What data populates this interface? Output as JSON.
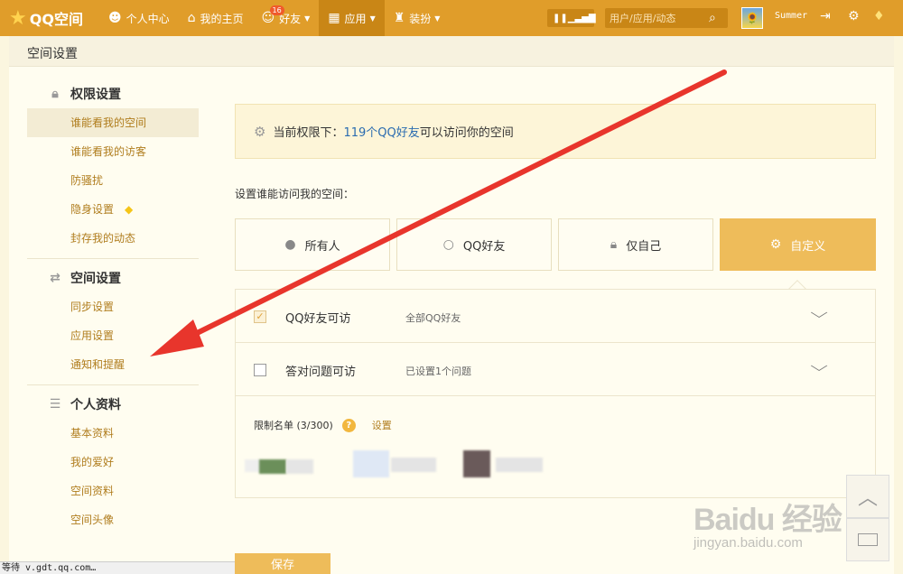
{
  "nav": {
    "logo_text": "QQ空间",
    "items": [
      {
        "label": "个人中心",
        "icon": "person-icon"
      },
      {
        "label": "我的主页",
        "icon": "home-icon"
      },
      {
        "label": "好友",
        "icon": "friends-icon",
        "badge": "16"
      },
      {
        "label": "应用",
        "icon": "grid-icon"
      },
      {
        "label": "装扮",
        "icon": "shirt-icon"
      }
    ],
    "search_placeholder": "用户/应用/动态",
    "username": "Summer"
  },
  "page": {
    "title": "空间设置"
  },
  "sidebar": {
    "sections": [
      {
        "title": "权限设置",
        "icon": "lock-icon",
        "items": [
          "谁能看我的空间",
          "谁能看我的访客",
          "防骚扰",
          "隐身设置",
          "封存我的动态"
        ]
      },
      {
        "title": "空间设置",
        "icon": "space-icon",
        "items": [
          "同步设置",
          "应用设置",
          "通知和提醒"
        ]
      },
      {
        "title": "个人资料",
        "icon": "profile-icon",
        "items": [
          "基本资料",
          "我的爱好",
          "空间资料",
          "空间头像"
        ]
      }
    ]
  },
  "notice": {
    "prefix": "当前权限下：",
    "highlight": "119个QQ好友",
    "suffix": "可以访问你的空间"
  },
  "prompt": "设置谁能访问我的空间：",
  "options": [
    "所有人",
    "QQ好友",
    "仅自己",
    "自定义"
  ],
  "rows": [
    {
      "label": "QQ好友可访",
      "desc": "全部QQ好友",
      "checked": true
    },
    {
      "label": "答对问题可访",
      "desc": "已设置1个问题",
      "checked": false
    }
  ],
  "limit": {
    "label": "限制名单 (3/300)",
    "help": "?",
    "action": "设置"
  },
  "save_label": "保存",
  "status_text": "等待 v.gdt.qq.com…",
  "watermark": {
    "brand": "Baidu 经验",
    "url": "jingyan.baidu.com"
  },
  "colors": {
    "nav": "#e09d2a",
    "accent": "#eebc5a",
    "link": "#b07d1e",
    "arrow": "#e8352c"
  }
}
